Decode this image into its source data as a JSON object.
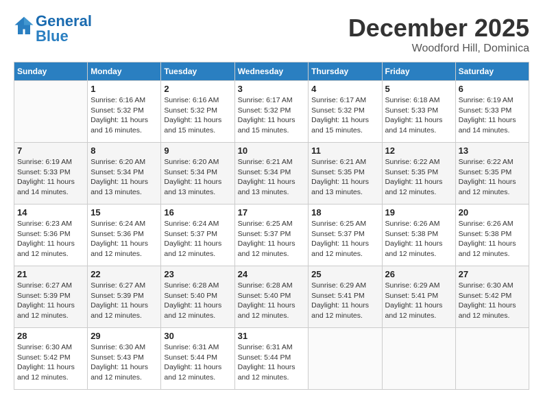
{
  "logo": {
    "text_general": "General",
    "text_blue": "Blue"
  },
  "title": "December 2025",
  "location": "Woodford Hill, Dominica",
  "header_days": [
    "Sunday",
    "Monday",
    "Tuesday",
    "Wednesday",
    "Thursday",
    "Friday",
    "Saturday"
  ],
  "weeks": [
    [
      {
        "day": "",
        "info": ""
      },
      {
        "day": "1",
        "info": "Sunrise: 6:16 AM\nSunset: 5:32 PM\nDaylight: 11 hours\nand 16 minutes."
      },
      {
        "day": "2",
        "info": "Sunrise: 6:16 AM\nSunset: 5:32 PM\nDaylight: 11 hours\nand 15 minutes."
      },
      {
        "day": "3",
        "info": "Sunrise: 6:17 AM\nSunset: 5:32 PM\nDaylight: 11 hours\nand 15 minutes."
      },
      {
        "day": "4",
        "info": "Sunrise: 6:17 AM\nSunset: 5:32 PM\nDaylight: 11 hours\nand 15 minutes."
      },
      {
        "day": "5",
        "info": "Sunrise: 6:18 AM\nSunset: 5:33 PM\nDaylight: 11 hours\nand 14 minutes."
      },
      {
        "day": "6",
        "info": "Sunrise: 6:19 AM\nSunset: 5:33 PM\nDaylight: 11 hours\nand 14 minutes."
      }
    ],
    [
      {
        "day": "7",
        "info": ""
      },
      {
        "day": "8",
        "info": "Sunrise: 6:20 AM\nSunset: 5:34 PM\nDaylight: 11 hours\nand 13 minutes."
      },
      {
        "day": "9",
        "info": "Sunrise: 6:20 AM\nSunset: 5:34 PM\nDaylight: 11 hours\nand 13 minutes."
      },
      {
        "day": "10",
        "info": "Sunrise: 6:21 AM\nSunset: 5:34 PM\nDaylight: 11 hours\nand 13 minutes."
      },
      {
        "day": "11",
        "info": "Sunrise: 6:21 AM\nSunset: 5:35 PM\nDaylight: 11 hours\nand 13 minutes."
      },
      {
        "day": "12",
        "info": "Sunrise: 6:22 AM\nSunset: 5:35 PM\nDaylight: 11 hours\nand 12 minutes."
      },
      {
        "day": "13",
        "info": "Sunrise: 6:22 AM\nSunset: 5:35 PM\nDaylight: 11 hours\nand 12 minutes."
      }
    ],
    [
      {
        "day": "14",
        "info": ""
      },
      {
        "day": "15",
        "info": "Sunrise: 6:24 AM\nSunset: 5:36 PM\nDaylight: 11 hours\nand 12 minutes."
      },
      {
        "day": "16",
        "info": "Sunrise: 6:24 AM\nSunset: 5:37 PM\nDaylight: 11 hours\nand 12 minutes."
      },
      {
        "day": "17",
        "info": "Sunrise: 6:25 AM\nSunset: 5:37 PM\nDaylight: 11 hours\nand 12 minutes."
      },
      {
        "day": "18",
        "info": "Sunrise: 6:25 AM\nSunset: 5:37 PM\nDaylight: 11 hours\nand 12 minutes."
      },
      {
        "day": "19",
        "info": "Sunrise: 6:26 AM\nSunset: 5:38 PM\nDaylight: 11 hours\nand 12 minutes."
      },
      {
        "day": "20",
        "info": "Sunrise: 6:26 AM\nSunset: 5:38 PM\nDaylight: 11 hours\nand 12 minutes."
      }
    ],
    [
      {
        "day": "21",
        "info": ""
      },
      {
        "day": "22",
        "info": "Sunrise: 6:27 AM\nSunset: 5:39 PM\nDaylight: 11 hours\nand 12 minutes."
      },
      {
        "day": "23",
        "info": "Sunrise: 6:28 AM\nSunset: 5:40 PM\nDaylight: 11 hours\nand 12 minutes."
      },
      {
        "day": "24",
        "info": "Sunrise: 6:28 AM\nSunset: 5:40 PM\nDaylight: 11 hours\nand 12 minutes."
      },
      {
        "day": "25",
        "info": "Sunrise: 6:29 AM\nSunset: 5:41 PM\nDaylight: 11 hours\nand 12 minutes."
      },
      {
        "day": "26",
        "info": "Sunrise: 6:29 AM\nSunset: 5:41 PM\nDaylight: 11 hours\nand 12 minutes."
      },
      {
        "day": "27",
        "info": "Sunrise: 6:30 AM\nSunset: 5:42 PM\nDaylight: 11 hours\nand 12 minutes."
      }
    ],
    [
      {
        "day": "28",
        "info": "Sunrise: 6:30 AM\nSunset: 5:42 PM\nDaylight: 11 hours\nand 12 minutes."
      },
      {
        "day": "29",
        "info": "Sunrise: 6:30 AM\nSunset: 5:43 PM\nDaylight: 11 hours\nand 12 minutes."
      },
      {
        "day": "30",
        "info": "Sunrise: 6:31 AM\nSunset: 5:44 PM\nDaylight: 11 hours\nand 12 minutes."
      },
      {
        "day": "31",
        "info": "Sunrise: 6:31 AM\nSunset: 5:44 PM\nDaylight: 11 hours\nand 12 minutes."
      },
      {
        "day": "",
        "info": ""
      },
      {
        "day": "",
        "info": ""
      },
      {
        "day": "",
        "info": ""
      }
    ]
  ],
  "week7_sunday_info": "Sunrise: 6:19 AM\nSunset: 5:33 PM\nDaylight: 11 hours\nand 14 minutes.",
  "week14_sunday_info": "Sunrise: 6:23 AM\nSunset: 5:36 PM\nDaylight: 11 hours\nand 12 minutes.",
  "week21_sunday_info": "Sunrise: 6:27 AM\nSunset: 5:39 PM\nDaylight: 11 hours\nand 12 minutes."
}
